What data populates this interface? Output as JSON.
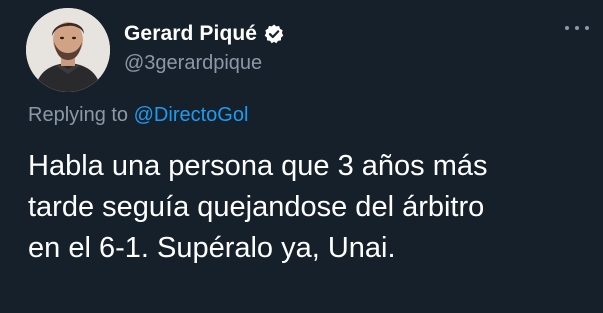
{
  "user": {
    "display_name": "Gerard Piqué",
    "handle": "@3gerardpique",
    "verified": true
  },
  "reply": {
    "prefix": "Replying to ",
    "mention": "@DirectoGol"
  },
  "tweet": {
    "lines": [
      "Habla una persona que 3 años más",
      "tarde seguía quejandose del árbitro",
      "en el 6-1. Supéralo ya, Unai."
    ]
  },
  "colors": {
    "background": "#15202b",
    "text": "#ffffff",
    "secondary": "#8b98a5",
    "accent": "#1d9bf0"
  },
  "icons": {
    "verified": "verified-badge-icon",
    "more": "more-options-icon"
  }
}
